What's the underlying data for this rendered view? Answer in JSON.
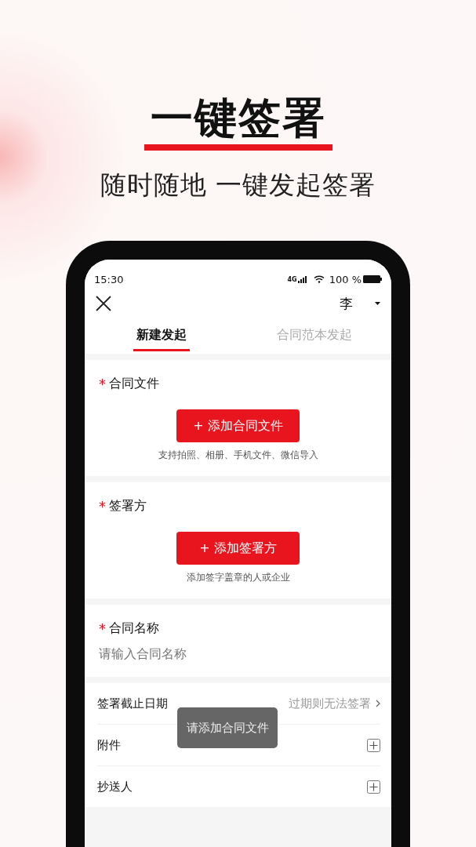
{
  "hero": {
    "title": "一键签署",
    "subtitle": "随时随地 一键发起签署"
  },
  "status_bar": {
    "time": "15:30",
    "network": "4G",
    "battery": "100 %"
  },
  "nav": {
    "user": "李"
  },
  "tabs": [
    {
      "label": "新建发起",
      "selected": true
    },
    {
      "label": "合同范本发起",
      "selected": false
    }
  ],
  "sections": [
    {
      "label": "合同文件",
      "required_mark": "*",
      "button": "+ 添加合同文件",
      "hint": "支持拍照、相册、手机文件、微信导入"
    },
    {
      "label": "签署方",
      "required_mark": "*",
      "button": "+ 添加签署方",
      "hint": "添加签字盖章的人或企业"
    }
  ],
  "name_field": {
    "label": "合同名称",
    "required_mark": "*",
    "placeholder": "请输入合同名称"
  },
  "rows": [
    {
      "label": "签署截止日期",
      "kind": "link",
      "value": "过期则无法签署"
    },
    {
      "label": "附件",
      "kind": "add"
    },
    {
      "label": "抄送人",
      "kind": "add"
    }
  ],
  "toast": "请添加合同文件"
}
